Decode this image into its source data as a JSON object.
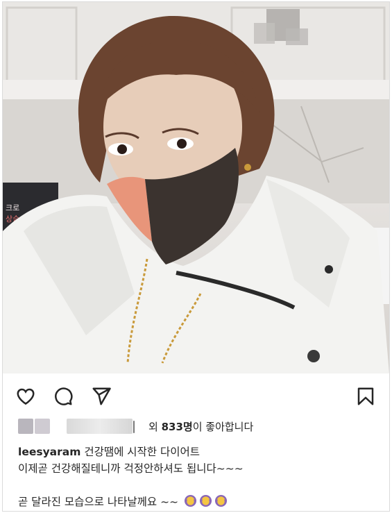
{
  "post": {
    "image_alt": "selfie-photo",
    "liked_by_text": "외 ",
    "likes_count": "833명",
    "likes_suffix": "이 좋아합니다",
    "caption": {
      "username": "leesyaram",
      "line1": " 건강땜에 시작한 다이어트",
      "line2": "이제곧 건강해질테니까 걱정안하셔도 됩니다~~~",
      "line3": "",
      "line4": "곧 달라진 모습으로 나타날께요 ~~"
    },
    "icons": [
      "heart-icon",
      "comment-icon",
      "share-icon",
      "bookmark-icon",
      "person-emoji-icon"
    ],
    "colors": {
      "text": "#262626",
      "border": "#dbdbdb",
      "mask_dark": "#3b332f",
      "mask_orange": "#e8957a"
    }
  }
}
